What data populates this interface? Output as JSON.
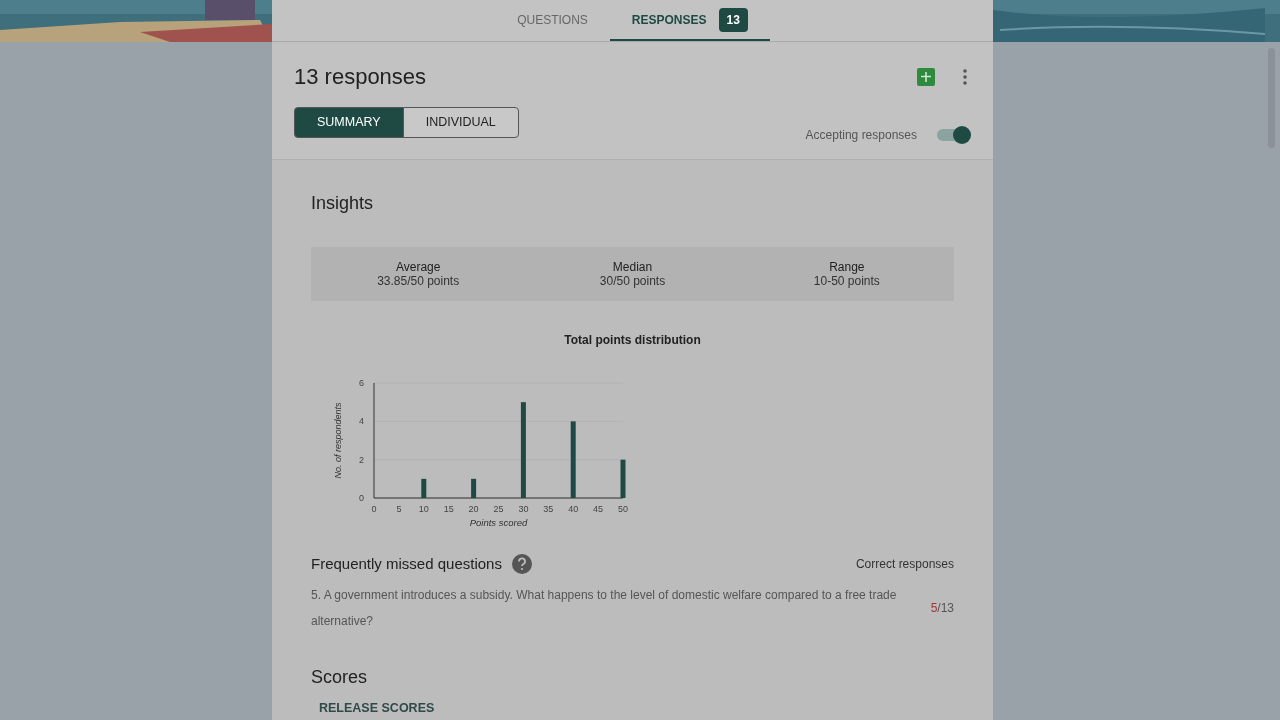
{
  "tabs": [
    {
      "label": "QUESTIONS",
      "selected": false
    },
    {
      "label": "RESPONSES",
      "selected": true,
      "badge": "13"
    }
  ],
  "header": {
    "title": "13 responses",
    "views": [
      {
        "label": "SUMMARY",
        "selected": true
      },
      {
        "label": "INDIVIDUAL",
        "selected": false
      }
    ],
    "accepting": {
      "label": "Accepting responses",
      "on": true
    }
  },
  "insights": {
    "title": "Insights",
    "stats": [
      {
        "label": "Average",
        "value": "33.85/50 points"
      },
      {
        "label": "Median",
        "value": "30/50 points"
      },
      {
        "label": "Range",
        "value": "10-50 points"
      }
    ],
    "chart_data": {
      "type": "bar",
      "title": "Total points distribution",
      "xlabel": "Points scored",
      "ylabel": "No. of respondents",
      "x": [
        10,
        20,
        30,
        40,
        50
      ],
      "values": [
        1,
        1,
        5,
        4,
        2
      ],
      "xlim": [
        0,
        50
      ],
      "ylim": [
        0,
        6
      ],
      "xticks": [
        0,
        5,
        10,
        15,
        20,
        25,
        30,
        35,
        40,
        45,
        50
      ],
      "yticks": [
        0,
        2,
        4,
        6
      ]
    }
  },
  "missed": {
    "title": "Frequently missed questions",
    "column": "Correct responses",
    "items": [
      {
        "question": "5. A government introduces a subsidy. What happens to the level of domestic welfare compared to a free trade alternative?",
        "correct": "5",
        "total": "/13"
      }
    ]
  },
  "scores": {
    "title": "Scores",
    "action": "RELEASE SCORES"
  }
}
